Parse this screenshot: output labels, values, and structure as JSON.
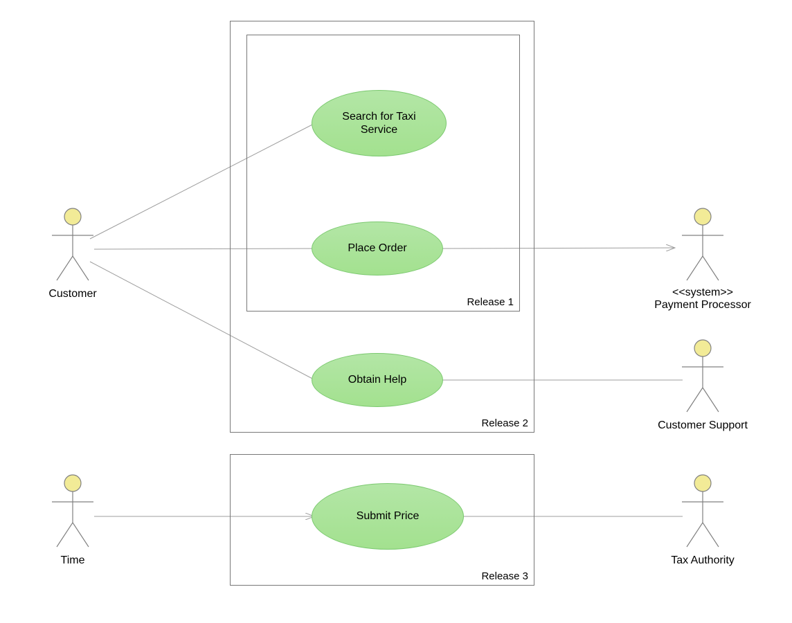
{
  "colors": {
    "ellipseFillTop": "#b3e6a6",
    "ellipseFillBottom": "#a3e18f",
    "ellipseStroke": "#7bc96f",
    "actorHead": "#f2eb97",
    "actorStroke": "#808080",
    "boxStroke": "#888888",
    "lineStroke": "#9d9d9d"
  },
  "actors": {
    "customer": {
      "label": "Customer"
    },
    "time": {
      "label": "Time"
    },
    "paymentProcessor": {
      "stereotype": "<<system>>",
      "label": "Payment Processor"
    },
    "customerSupport": {
      "label": "Customer Support"
    },
    "taxAuthority": {
      "label": "Tax Authority"
    }
  },
  "useCases": {
    "search": {
      "label": "Search for Taxi\nService"
    },
    "placeOrder": {
      "label": "Place Order"
    },
    "obtainHelp": {
      "label": "Obtain Help"
    },
    "submitPrice": {
      "label": "Submit Price"
    }
  },
  "boxes": {
    "release1": {
      "label": "Release 1"
    },
    "release2": {
      "label": "Release 2"
    },
    "release3": {
      "label": "Release 3"
    }
  }
}
